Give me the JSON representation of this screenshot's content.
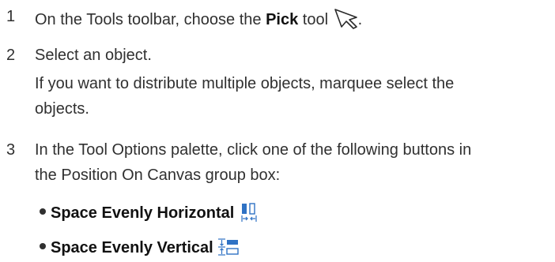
{
  "steps": [
    {
      "number": "1",
      "text_before": "On the Tools toolbar, choose the ",
      "bold": "Pick",
      "text_after": " tool",
      "icon": "pick-tool-arrow-icon",
      "trailing": "."
    },
    {
      "number": "2",
      "text": "Select an object.",
      "note_line1": "If you want to distribute multiple objects, marquee select the",
      "note_line2": "objects."
    },
    {
      "number": "3",
      "line1": "In the Tool Options palette, click one of the following buttons in",
      "line2": "the Position On Canvas group box:"
    }
  ],
  "bullets": [
    {
      "label": "Space Evenly Horizontal",
      "icon": "space-evenly-horizontal-icon"
    },
    {
      "label": "Space Evenly Vertical",
      "icon": "space-evenly-vertical-icon"
    }
  ],
  "colors": {
    "text": "#303030",
    "icon_blue": "#2f72c4",
    "icon_fill": "#a9cdf0"
  }
}
